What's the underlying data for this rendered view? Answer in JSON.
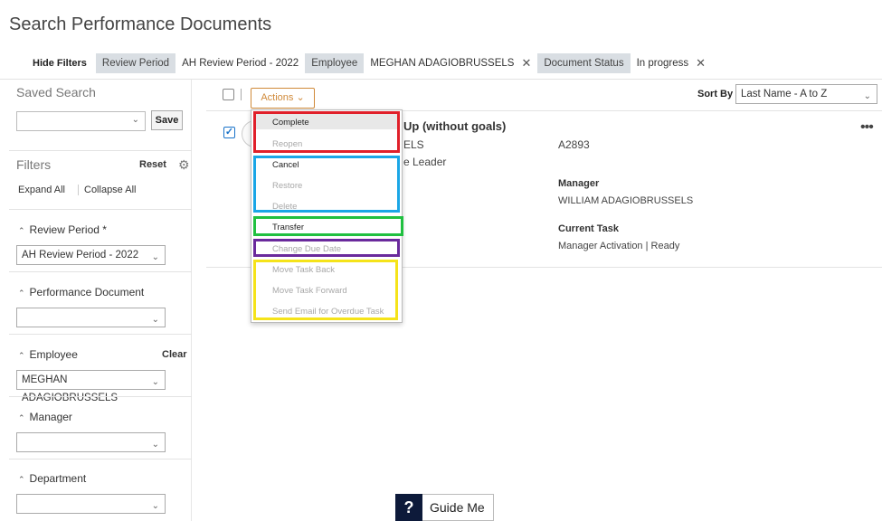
{
  "title": "Search Performance Documents",
  "filter_bar": {
    "hide_filters": "Hide Filters",
    "chips": [
      {
        "label": "Review Period",
        "value": "AH Review Period - 2022",
        "removable": false
      },
      {
        "label": "Employee",
        "value": "MEGHAN ADAGIOBRUSSELS",
        "removable": true
      },
      {
        "label": "Document Status",
        "value": "In progress",
        "removable": true
      }
    ],
    "remove_glyph": "✕"
  },
  "sidebar": {
    "saved_search": "Saved Search",
    "save_button": "Save",
    "filters": "Filters",
    "reset": "Reset",
    "expand_all": "Expand All",
    "collapse_all": "Collapse All",
    "sections": {
      "review_period": {
        "label": "Review Period *",
        "value": "AH Review Period - 2022"
      },
      "performance_document": {
        "label": "Performance Document",
        "value": ""
      },
      "employee": {
        "label": "Employee",
        "clear": "Clear",
        "value": "MEGHAN ADAGIOBRUSSELS"
      },
      "manager": {
        "label": "Manager",
        "value": ""
      },
      "department": {
        "label": "Department",
        "value": ""
      }
    }
  },
  "toolbar": {
    "actions": "Actions",
    "sort_by": "Sort By",
    "sort_value": "Last Name - A to Z"
  },
  "document": {
    "title_partial": "Up (without goals)",
    "employee_partial": "ELS",
    "employee_id": "A2893",
    "role_partial": "e Leader",
    "manager_label": "Manager",
    "manager_value": "WILLIAM ADAGIOBRUSSELS",
    "current_task_label": "Current Task",
    "current_task_value": "Manager Activation | Ready",
    "more": "•••"
  },
  "actions_menu": {
    "items": [
      {
        "label": "Complete",
        "enabled": true
      },
      {
        "label": "Reopen",
        "enabled": false
      },
      {
        "label": "Cancel",
        "enabled": true
      },
      {
        "label": "Restore",
        "enabled": false
      },
      {
        "label": "Delete",
        "enabled": false
      },
      {
        "label": "Transfer",
        "enabled": true
      },
      {
        "label": "Change Due Date",
        "enabled": false
      },
      {
        "label": "Move Task Back",
        "enabled": false
      },
      {
        "label": "Move Task Forward",
        "enabled": false
      },
      {
        "label": "Send Email for Overdue Task",
        "enabled": false
      }
    ],
    "highlight_colors": {
      "red": "#e0202a",
      "blue": "#1aa6e6",
      "green": "#20c040",
      "purple": "#6a2a9c",
      "yellow": "#f5e31a"
    }
  },
  "guide": {
    "icon": "?",
    "label": "Guide Me"
  },
  "colors": {
    "accent_orange": "#d08a3a",
    "checkbox_blue": "#1a73c9",
    "chip_gray": "#d9dee3",
    "guide_navy": "#0d1a3a"
  }
}
